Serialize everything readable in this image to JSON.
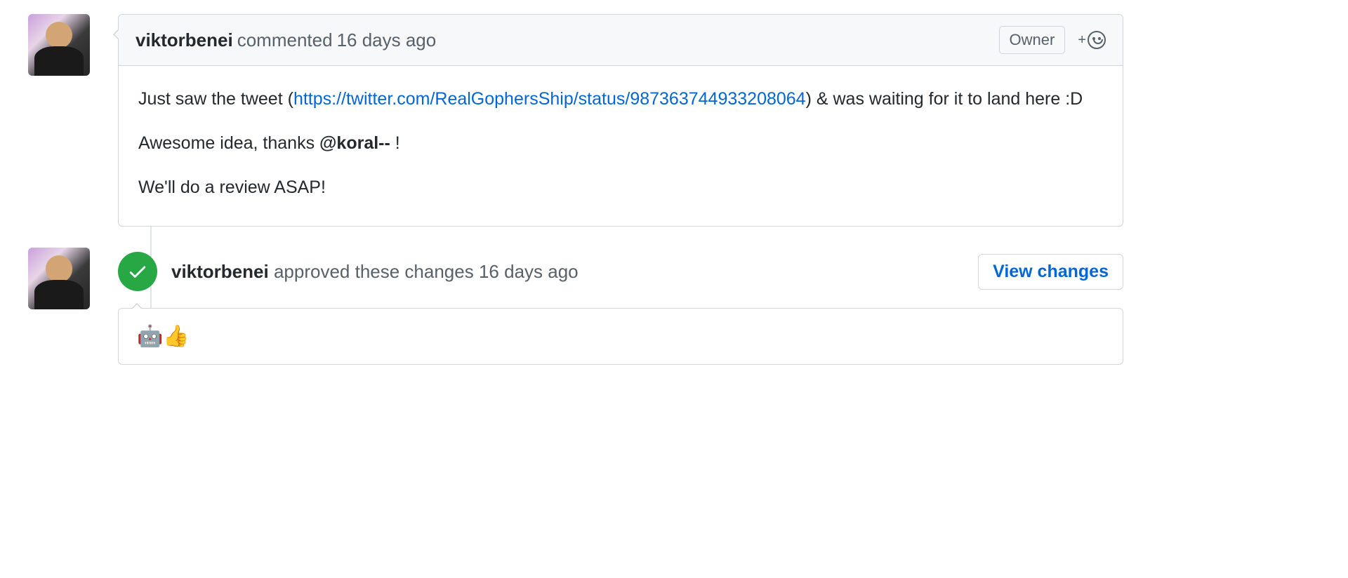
{
  "comment": {
    "author": "viktorbenei",
    "action": "commented",
    "timestamp": "16 days ago",
    "badge": "Owner",
    "body_prefix": "Just saw the tweet (",
    "body_link": "https://twitter.com/RealGophersShip/status/987363744933208064",
    "body_suffix": ") & was waiting for it to land here :D",
    "body_line2_prefix": "Awesome idea, thanks ",
    "body_line2_mention": "@koral--",
    "body_line2_suffix": " !",
    "body_line3": "We'll do a review ASAP!"
  },
  "review": {
    "author": "viktorbenei",
    "action": "approved these changes",
    "timestamp": "16 days ago",
    "view_changes_label": "View changes",
    "body_emoji": "🤖👍"
  }
}
